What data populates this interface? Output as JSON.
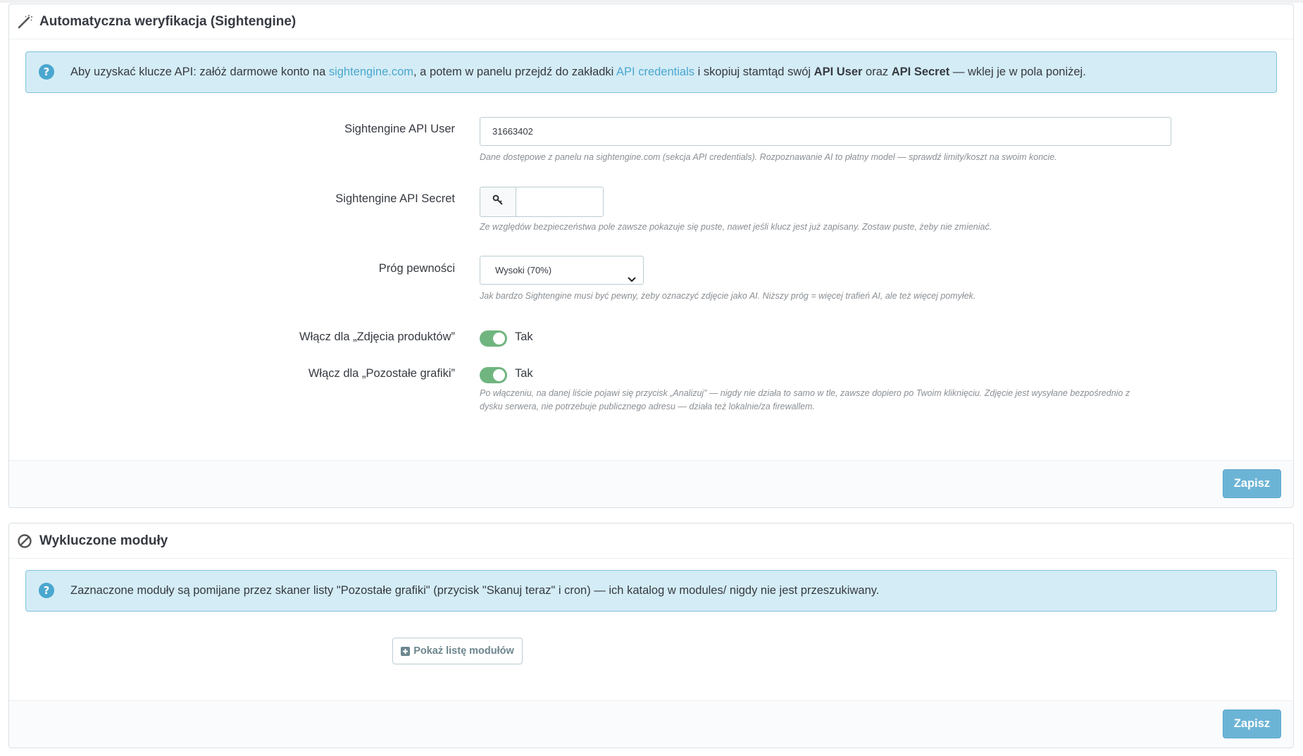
{
  "panel_sightengine": {
    "title": "Automatyczna weryfikacja (Sightengine)",
    "alert": {
      "prefix": "Aby uzyskać klucze API: załóż darmowe konto na ",
      "link1": "sightengine.com",
      "mid1": ", a potem w panelu przejdź do zakładki ",
      "link2": "API credentials",
      "mid2": " i skopiuj stamtąd swój ",
      "bold1": "API User",
      "mid3": " oraz ",
      "bold2": "API Secret",
      "suffix": " — wklej je w pola poniżej."
    },
    "api_user": {
      "label": "Sightengine API User",
      "value": "31663402",
      "help": "Dane dostępowe z panelu na sightengine.com (sekcja API credentials). Rozpoznawanie AI to płatny model — sprawdź limity/koszt na swoim koncie."
    },
    "api_secret": {
      "label": "Sightengine API Secret",
      "value": "",
      "help": "Ze względów bezpieczeństwa pole zawsze pokazuje się puste, nawet jeśli klucz jest już zapisany. Zostaw puste, żeby nie zmieniać."
    },
    "threshold": {
      "label": "Próg pewności",
      "selected": "Wysoki (70%)",
      "help": "Jak bardzo Sightengine musi być pewny, żeby oznaczyć zdjęcie jako AI. Niższy próg = więcej trafień AI, ale też więcej pomyłek."
    },
    "toggle_products": {
      "label": "Włącz dla „Zdjęcia produktów”",
      "state": "Tak",
      "on": true
    },
    "toggle_other": {
      "label": "Włącz dla „Pozostałe grafiki”",
      "state": "Tak",
      "on": true,
      "help_line1": "Po włączeniu, na danej liście pojawi się przycisk „Analizuj” — nigdy nie działa to samo w tle, zawsze dopiero po Twoim kliknięciu. Zdjęcie jest wysyłane bezpośrednio z",
      "help_line2": "dysku serwera, nie potrzebuje publicznego adresu — działa też lokalnie/za firewallem."
    },
    "save_label": "Zapisz"
  },
  "panel_excluded": {
    "title": "Wykluczone moduły",
    "alert": "Zaznaczone moduły są pomijane przez skaner listy \"Pozostałe grafiki\" (przycisk \"Skanuj teraz\" i cron) — ich katalog w modules/ nigdy nie jest przeszukiwany.",
    "show_list_label": "Pokaż listę modułów",
    "save_label": "Zapisz"
  },
  "colors": {
    "accent": "#6cb4d6",
    "alert_bg": "#d4ecf5",
    "alert_border": "#81c3dc",
    "link": "#4aa7cf",
    "switch_on": "#70b580"
  },
  "icons": {
    "panel1": "magic-wand-icon",
    "panel2": "ban-icon",
    "alert": "question-circle-icon",
    "secret_addon": "key-icon",
    "show_list": "plus-square-icon"
  }
}
